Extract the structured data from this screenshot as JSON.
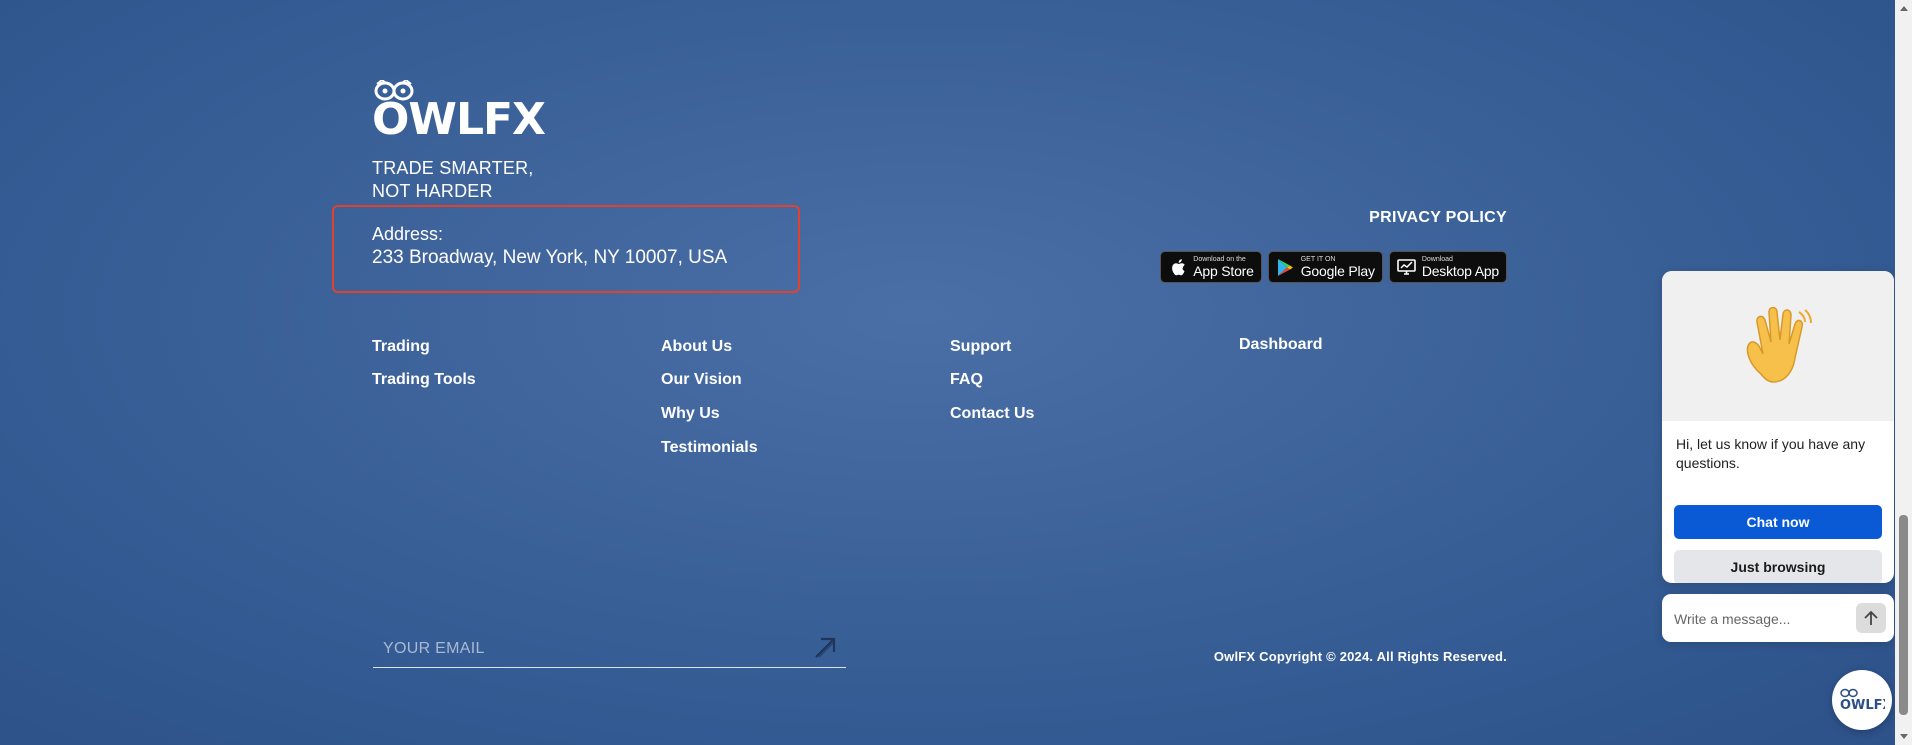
{
  "brand": {
    "logo_text": "OWLFX",
    "tagline_line1": "TRADE SMARTER,",
    "tagline_line2": "NOT HARDER"
  },
  "address": {
    "label": "Address:",
    "value": "233 Broadway, New York, NY  10007, USA"
  },
  "top_right": {
    "privacy_policy": "PRIVACY POLICY",
    "stores": [
      {
        "small": "Download on the",
        "big": "App Store",
        "icon": "apple-icon"
      },
      {
        "small": "GET IT ON",
        "big": "Google Play",
        "icon": "google-play-icon"
      },
      {
        "small": "Download",
        "big": "Desktop App",
        "icon": "desktop-icon"
      }
    ]
  },
  "columns": {
    "trading": {
      "title": "Trading",
      "links": [
        "Trading Tools"
      ]
    },
    "about": {
      "title": "About Us",
      "links": [
        "Our Vision",
        "Why Us",
        "Testimonials"
      ]
    },
    "support": {
      "title": "Support",
      "links": [
        "FAQ",
        "Contact Us"
      ]
    },
    "dashboard": {
      "links": [
        "Dashboard"
      ]
    }
  },
  "newsletter": {
    "placeholder": "YOUR EMAIL",
    "send_icon": "send-arrow-icon"
  },
  "copyright": "OwlFX Copyright © 2024. All Rights Reserved.",
  "chat": {
    "message": "Hi, let us know if you have any questions.",
    "chat_now_label": "Chat now",
    "just_browsing_label": "Just browsing",
    "input_placeholder": "Write a message...",
    "hero_icon": "waving-hand-icon",
    "launcher_icon": "owlfx-logo-icon"
  },
  "colors": {
    "background": "#3f649c",
    "highlight_border": "#e0422e",
    "chat_primary": "#0a5ad6"
  }
}
